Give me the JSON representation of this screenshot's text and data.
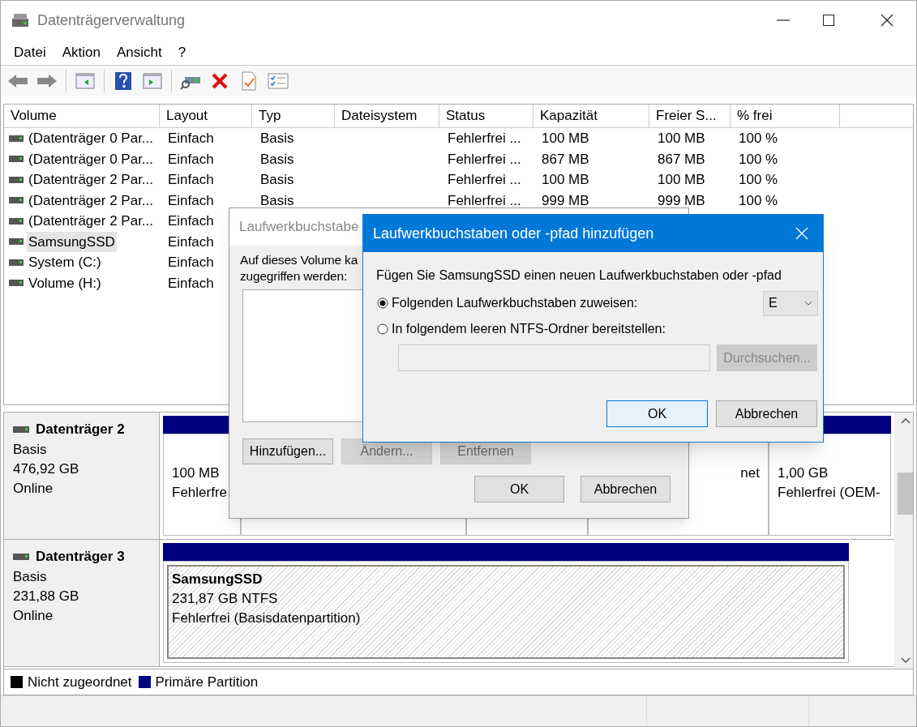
{
  "window": {
    "title": "Datenträgerverwaltung"
  },
  "menu": [
    "Datei",
    "Aktion",
    "Ansicht",
    "?"
  ],
  "volume_table": {
    "columns": [
      "Volume",
      "Layout",
      "Typ",
      "Dateisystem",
      "Status",
      "Kapazität",
      "Freier S...",
      "% frei"
    ],
    "rows": [
      {
        "selected": false,
        "cells": [
          "(Datenträger 0 Par...",
          "Einfach",
          "Basis",
          "",
          "Fehlerfrei ...",
          "100 MB",
          "100 MB",
          "100 %"
        ]
      },
      {
        "selected": false,
        "cells": [
          "(Datenträger 0 Par...",
          "Einfach",
          "Basis",
          "",
          "Fehlerfrei ...",
          "867 MB",
          "867 MB",
          "100 %"
        ]
      },
      {
        "selected": false,
        "cells": [
          "(Datenträger 2 Par...",
          "Einfach",
          "Basis",
          "",
          "Fehlerfrei ...",
          "100 MB",
          "100 MB",
          "100 %"
        ]
      },
      {
        "selected": false,
        "cells": [
          "(Datenträger 2 Par...",
          "Einfach",
          "Basis",
          "",
          "Fehlerfrei ...",
          "999 MB",
          "999 MB",
          "100 %"
        ]
      },
      {
        "selected": false,
        "cells": [
          "(Datenträger 2 Par...",
          "Einfach"
        ]
      },
      {
        "selected": true,
        "cells": [
          "SamsungSSD",
          "Einfach"
        ]
      },
      {
        "selected": false,
        "cells": [
          "System (C:)",
          "Einfach"
        ]
      },
      {
        "selected": false,
        "cells": [
          "Volume (H:)",
          "Einfach"
        ]
      }
    ]
  },
  "disks": [
    {
      "name": "Datenträger 2",
      "type": "Basis",
      "size": "476,92 GB",
      "state": "Online",
      "partitions": [
        {
          "selected": false,
          "lines": [
            "100 MB",
            "Fehlerfre"
          ]
        },
        {
          "selected": false
        },
        {
          "selected": false
        },
        {
          "selected": false,
          "lines": [
            "net"
          ]
        },
        {
          "selected": false,
          "lines": [
            "1,00 GB",
            "Fehlerfrei (OEM-"
          ]
        }
      ]
    },
    {
      "name": "Datenträger 3",
      "type": "Basis",
      "size": "231,88 GB",
      "state": "Online",
      "partitions": [
        {
          "selected": true,
          "title": "SamsungSSD",
          "lines": [
            "231,87 GB NTFS",
            "Fehlerfrei (Basisdatenpartition)"
          ]
        }
      ]
    }
  ],
  "legend": [
    {
      "label": "Nicht zugeordnet",
      "color": "#000000"
    },
    {
      "label": "Primäre Partition",
      "color": "#000080"
    }
  ],
  "back_dialog": {
    "title": "Laufwerkbuchstabe",
    "text": [
      "Auf dieses Volume ka",
      "zugegriffen werden:"
    ],
    "buttons": [
      {
        "label": "Hinzufügen...",
        "disabled": false
      },
      {
        "label": "Ändern...",
        "disabled": true
      },
      {
        "label": "Entfernen",
        "disabled": true
      }
    ],
    "ok": "OK",
    "cancel": "Abbrechen"
  },
  "front_dialog": {
    "title": "Laufwerkbuchstaben oder -pfad hinzufügen",
    "prompt": "Fügen Sie SamsungSSD einen neuen Laufwerkbuchstaben oder -pfad",
    "options": [
      {
        "label": "Folgenden Laufwerkbuchstaben zuweisen:",
        "selected": true
      },
      {
        "label": "In folgendem leeren NTFS-Ordner bereitstellen:",
        "selected": false
      }
    ],
    "letter": "E",
    "path_disabled": true,
    "browse": {
      "label": "Durchsuchen...",
      "disabled": true
    },
    "ok": "OK",
    "cancel": "Abbrechen"
  }
}
